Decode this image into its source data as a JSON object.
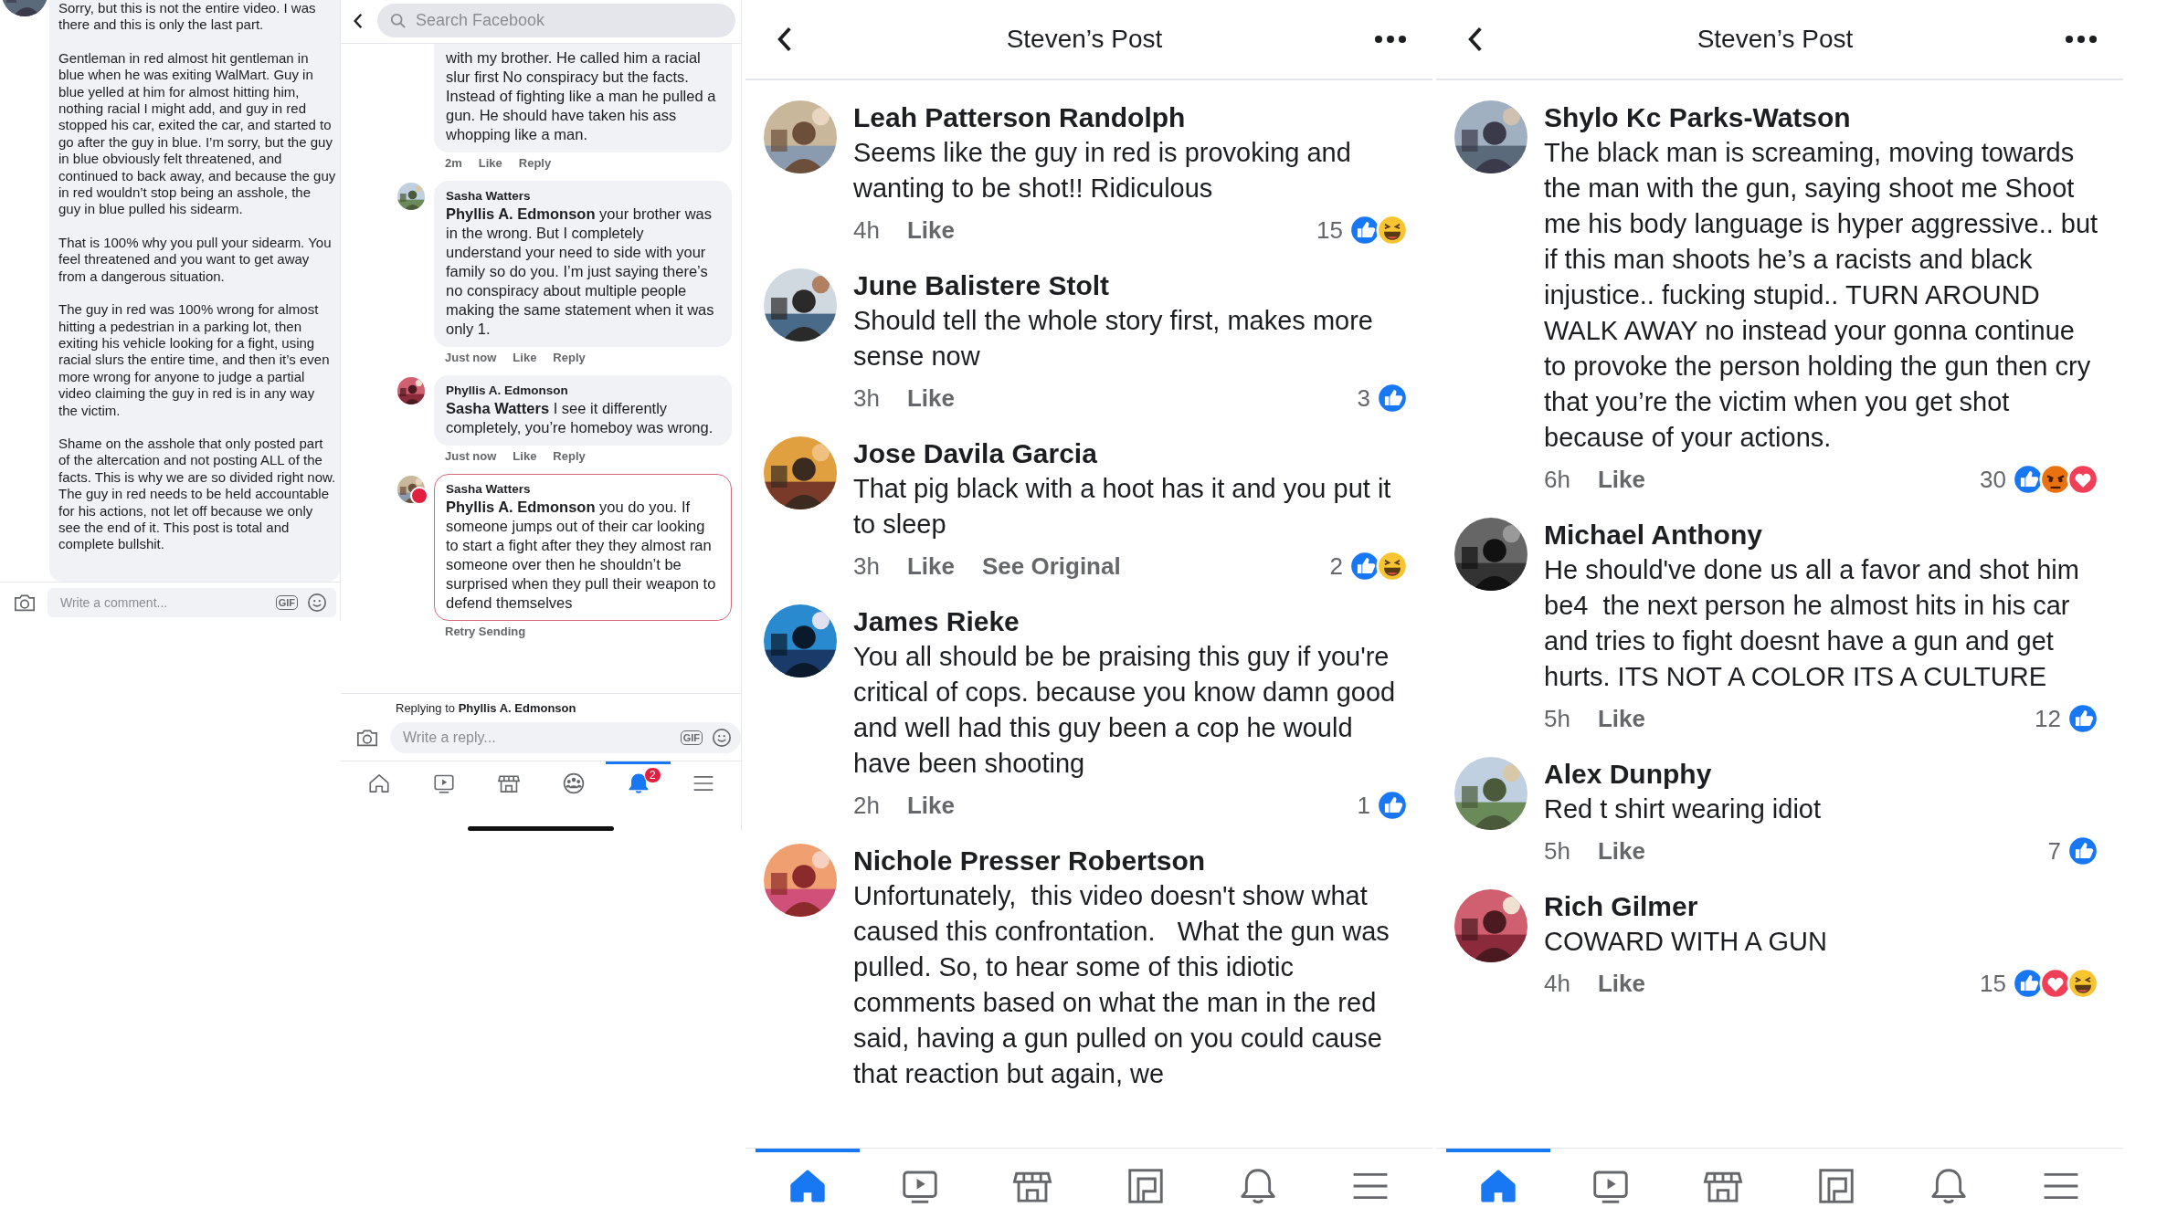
{
  "comment_panel": {
    "paragraphs": [
      "Sorry, but this is not the entire video.  I was there and this is only the last part.",
      "Gentleman in red almost hit gentleman in blue when he was exiting WalMart.  Guy in blue yelled at him for almost hitting him, nothing racial I might add, and guy in red stopped his car, exited the car, and started to go after the guy in blue.  I’m sorry, but the guy in blue obviously felt threatened, and continued to back away, and because the guy in red wouldn’t stop being an asshole, the guy in blue pulled his sidearm.",
      "That is 100% why you pull your sidearm. You feel threatened and you want to get away from a dangerous situation.",
      "The guy in red was 100% wrong for almost hitting a pedestrian in a parking lot, then exiting his vehicle looking for a fight, using racial slurs the entire time, and then it’s even more wrong for anyone to judge a partial video claiming the guy in red is in any way the victim.",
      "Shame on the asshole that only posted part of the altercation and not posting ALL of the facts.  This is why we are so divided right now.  The guy in red needs to be held accountable for his actions, not let off because we only see the end of it.  This post is total and complete bullshit."
    ],
    "placeholder": "Write a comment...",
    "gif": "GIF"
  },
  "reply_panel": {
    "search_placeholder": "Search Facebook",
    "comments": [
      {
        "text": "with my brother. He called him a racial slur first No conspiracy but the facts. Instead of fighting like a man he pulled a gun. He should have taken his ass whopping like a man.",
        "time": "2m",
        "like": "Like",
        "reply": "Reply",
        "failed": false
      },
      {
        "author": "Sasha Watters",
        "text": "**Phyllis A. Edmonson** your brother was in the wrong. But I completely understand your need to side with your family so do you. I’m just saying there’s no conspiracy about multiple people making the same statement when it was only 1.",
        "time": "Just now",
        "like": "Like",
        "reply": "Reply",
        "failed": false
      },
      {
        "author": "Phyllis A. Edmonson",
        "text": "**Sasha Watters** I see it differently completely, you’re homeboy was wrong.",
        "time": "Just now",
        "like": "Like",
        "reply": "Reply",
        "failed": false
      },
      {
        "author": "Sasha Watters",
        "text": "**Phyllis A. Edmonson**  you do you. If someone jumps out of their car looking to start a fight after they they almost ran someone over then he shouldn’t be surprised when  they pull their weapon to defend themselves",
        "status": "Retry Sending",
        "failed": true
      }
    ],
    "replying_to": "Replying to **Phyllis A. Edmonson**",
    "placeholder": "Write a reply...",
    "gif": "GIF",
    "nav": [
      {
        "kind": "home",
        "selected": false
      },
      {
        "kind": "video",
        "selected": false
      },
      {
        "kind": "store",
        "selected": false
      },
      {
        "kind": "groups",
        "selected": false
      },
      {
        "kind": "bell",
        "selected": true,
        "badge": "2"
      },
      {
        "kind": "menu",
        "selected": false
      }
    ]
  },
  "post_panels": [
    {
      "title": "Steven’s Post",
      "comments": [
        {
          "author": "Leah Patterson Randolph",
          "text": "Seems like the guy in red is provoking and wanting to be shot!! Ridiculous",
          "time": "4h",
          "like": "Like",
          "count": "15",
          "reactions": [
            {
              "kind": "like"
            },
            {
              "kind": "haha"
            }
          ]
        },
        {
          "author": "June Balistere Stolt",
          "text": "Should tell the whole story first, makes more sense now",
          "time": "3h",
          "like": "Like",
          "count": "3",
          "reactions": [
            {
              "kind": "like"
            }
          ]
        },
        {
          "author": "Jose Davila Garcia",
          "text": "That pig black with a hoot has it and you put it to sleep",
          "time": "3h",
          "like": "Like",
          "see_original": "See Original",
          "count": "2",
          "reactions": [
            {
              "kind": "like"
            },
            {
              "kind": "haha"
            }
          ]
        },
        {
          "author": "James Rieke",
          "text": "You all should be be praising this guy if you're critical of cops. because you know damn good and well had this guy been a cop he would have been shooting",
          "time": "2h",
          "like": "Like",
          "count": "1",
          "reactions": [
            {
              "kind": "like"
            }
          ]
        },
        {
          "author": "Nichole Presser Robertson",
          "text": "Unfortunately,  this video doesn't show what caused this confrontation.   What the gun was pulled. So, to hear some of this idiotic comments based on what the man in the red said, having a gun pulled on you could cause that reaction but again, we"
        }
      ],
      "nav": [
        {
          "kind": "home",
          "selected": true
        },
        {
          "kind": "video",
          "selected": false
        },
        {
          "kind": "store",
          "selected": false
        },
        {
          "kind": "pages",
          "selected": false
        },
        {
          "kind": "bell",
          "selected": false
        },
        {
          "kind": "menu",
          "selected": false
        }
      ]
    },
    {
      "title": "Steven’s Post",
      "comments": [
        {
          "author": "Shylo Kc Parks-Watson",
          "text": "The black man is screaming, moving towards the man with the gun, saying shoot me Shoot me his body language is hyper aggressive.. but if this man shoots he’s a racists and black injustice.. fucking stupid.. TURN AROUND WALK AWAY no instead your gonna continue to provoke the person holding the gun then cry that you’re the victim when you get shot because of your actions.",
          "time": "6h",
          "like": "Like",
          "count": "30",
          "reactions": [
            {
              "kind": "like"
            },
            {
              "kind": "angry"
            },
            {
              "kind": "love"
            }
          ]
        },
        {
          "author": "Michael Anthony",
          "text": "He should've done us all a favor and shot him be4  the next person he almost hits in his car and tries to fight doesnt have a gun and get hurts. ITS NOT A COLOR ITS A CULTURE",
          "time": "5h",
          "like": "Like",
          "count": "12",
          "reactions": [
            {
              "kind": "like"
            }
          ]
        },
        {
          "author": "Alex Dunphy",
          "text": "Red t shirt wearing idiot",
          "time": "5h",
          "like": "Like",
          "count": "7",
          "reactions": [
            {
              "kind": "like"
            }
          ]
        },
        {
          "author": "Rich Gilmer",
          "text": "COWARD WITH A GUN",
          "time": "4h",
          "like": "Like",
          "count": "15",
          "reactions": [
            {
              "kind": "like"
            },
            {
              "kind": "love"
            },
            {
              "kind": "haha"
            }
          ]
        }
      ],
      "nav": [
        {
          "kind": "home",
          "selected": true
        },
        {
          "kind": "video",
          "selected": false
        },
        {
          "kind": "store",
          "selected": false
        },
        {
          "kind": "pages",
          "selected": false
        },
        {
          "kind": "bell",
          "selected": false
        },
        {
          "kind": "menu",
          "selected": false
        }
      ]
    }
  ]
}
